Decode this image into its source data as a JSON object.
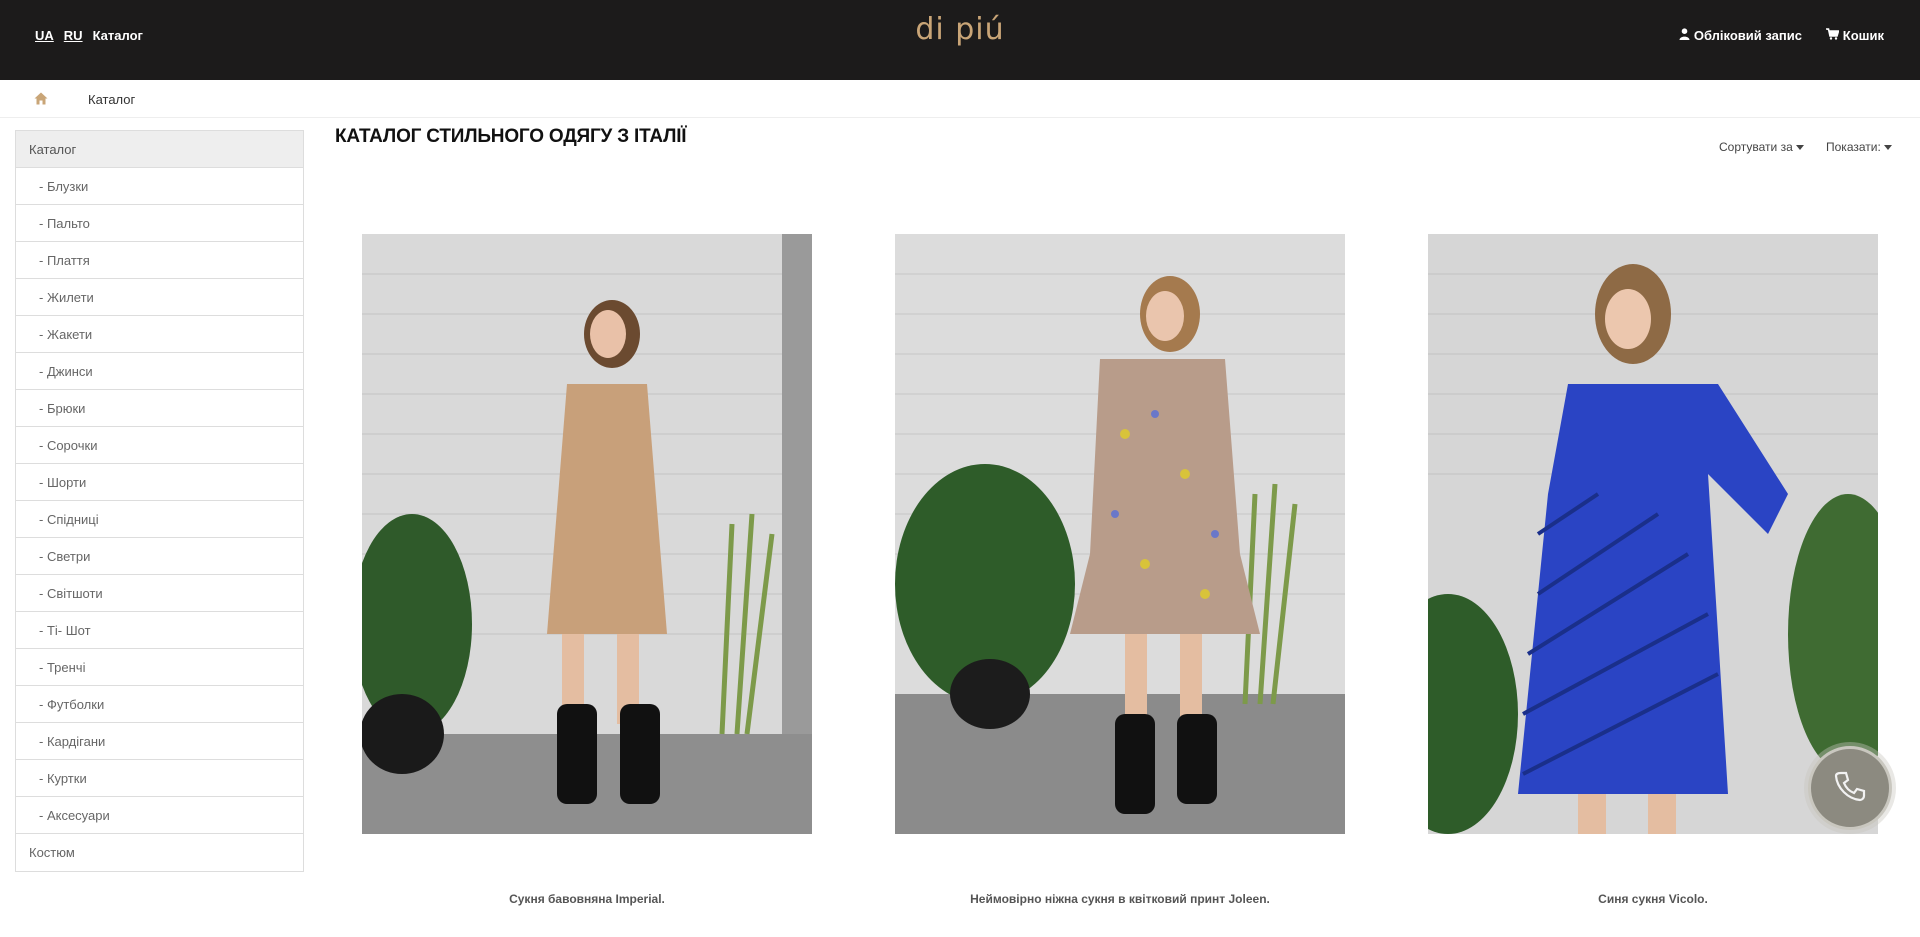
{
  "header": {
    "lang_ua": "UA",
    "lang_ru": "RU",
    "catalog_link": "Каталог",
    "logo": "di piú",
    "account": "Обліковий запис",
    "cart": "Кошик"
  },
  "breadcrumb": {
    "current": "Каталог"
  },
  "sidebar": {
    "items": [
      {
        "label": "Каталог"
      },
      {
        "label": "- Блузки"
      },
      {
        "label": "- Пальто"
      },
      {
        "label": "- Плаття"
      },
      {
        "label": "- Жилети"
      },
      {
        "label": "- Жакети"
      },
      {
        "label": "- Джинси"
      },
      {
        "label": "- Брюки"
      },
      {
        "label": "- Сорочки"
      },
      {
        "label": "- Шорти"
      },
      {
        "label": "- Спідниці"
      },
      {
        "label": "- Светри"
      },
      {
        "label": "- Світшоти"
      },
      {
        "label": "- Ті- Шот"
      },
      {
        "label": "- Тренчі"
      },
      {
        "label": "- Футболки"
      },
      {
        "label": "- Кардігани"
      },
      {
        "label": "- Куртки"
      },
      {
        "label": "- Аксесуари"
      },
      {
        "label": "Костюм"
      }
    ]
  },
  "main": {
    "title": "КАТАЛОГ СТИЛЬНОГО ОДЯГУ З ІТАЛІЇ",
    "sort_label": "Сортувати за",
    "show_label": "Показати:"
  },
  "products": [
    {
      "name": "Сукня бавовняна Imperial."
    },
    {
      "name": "Неймовірно ніжна сукня в квітковий принт Joleen."
    },
    {
      "name": "Синя сукня Vicolo."
    }
  ],
  "colors": {
    "header_bg": "#1c1b1b",
    "logo": "#c9a577",
    "sidebar_active": "#eeeeee"
  }
}
